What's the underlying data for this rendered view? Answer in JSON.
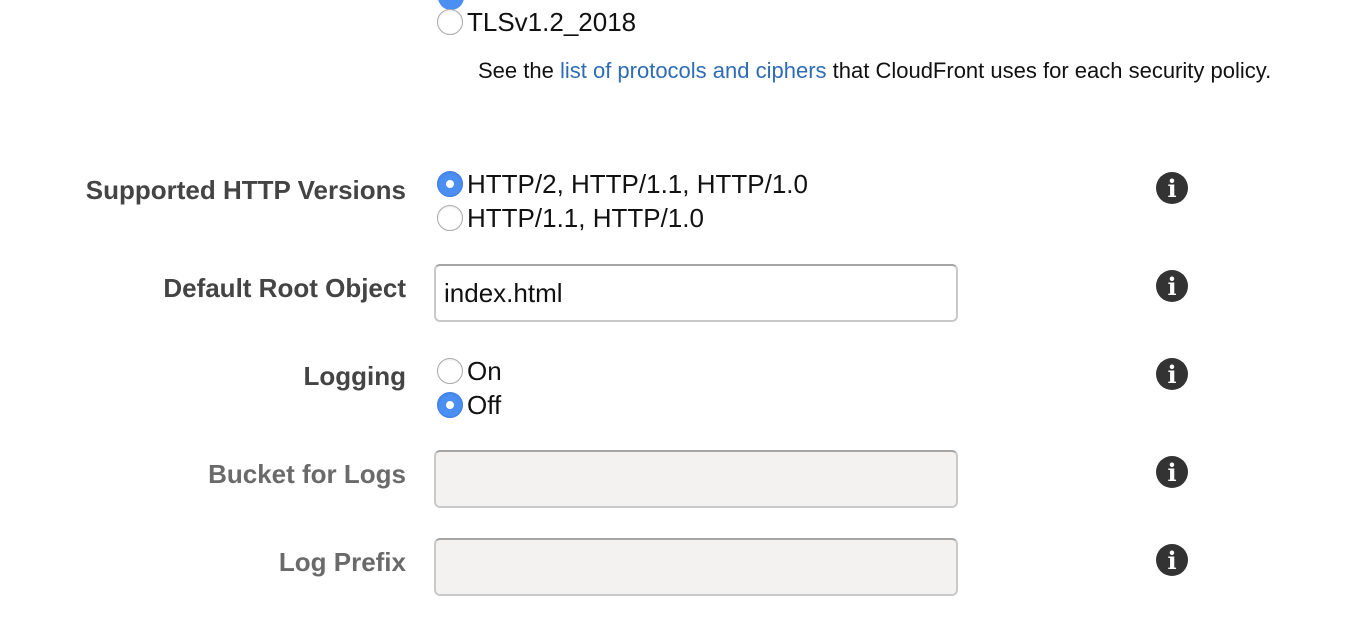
{
  "security_policy": {
    "options": [
      {
        "label": "TLSv1.2_2018",
        "checked": false
      }
    ],
    "note_prefix": "See the ",
    "note_link": "list of protocols and ciphers",
    "note_suffix": " that CloudFront uses for each security policy."
  },
  "http_versions": {
    "label": "Supported HTTP Versions",
    "options": [
      {
        "label": "HTTP/2, HTTP/1.1, HTTP/1.0",
        "checked": true
      },
      {
        "label": "HTTP/1.1, HTTP/1.0",
        "checked": false
      }
    ]
  },
  "default_root_object": {
    "label": "Default Root Object",
    "value": "index.html"
  },
  "logging": {
    "label": "Logging",
    "options": [
      {
        "label": "On",
        "checked": false
      },
      {
        "label": "Off",
        "checked": true
      }
    ]
  },
  "bucket_for_logs": {
    "label": "Bucket for Logs",
    "value": ""
  },
  "log_prefix": {
    "label": "Log Prefix",
    "value": ""
  },
  "info_icon_glyph": "i",
  "colors": {
    "accent": "#4b8ff2",
    "link": "#2e6cb5"
  }
}
